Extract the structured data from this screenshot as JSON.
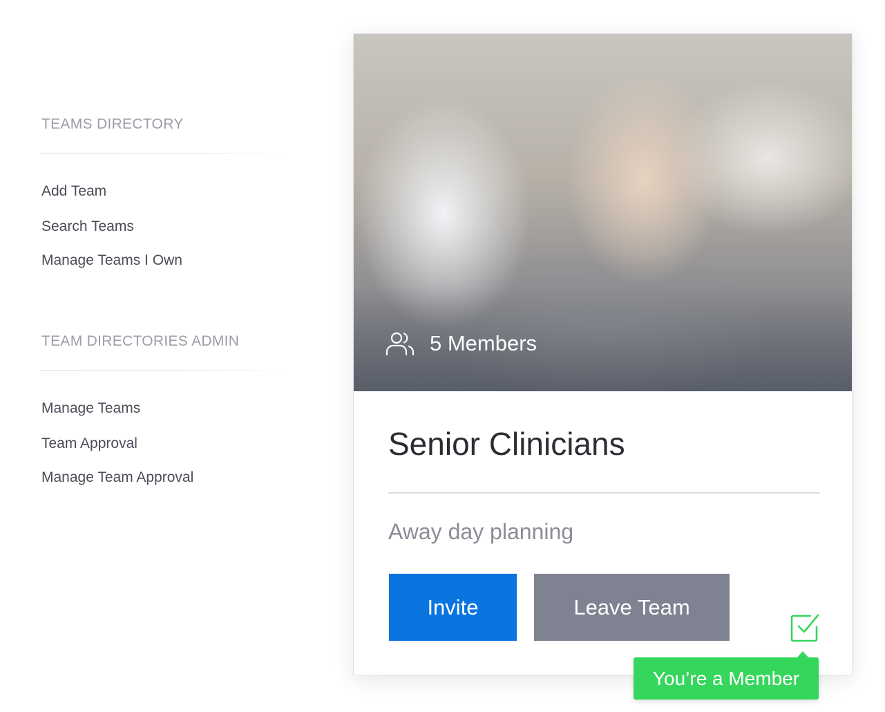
{
  "sidebar": {
    "sections": [
      {
        "title": "TEAMS DIRECTORY",
        "items": [
          "Add Team",
          "Search Teams",
          "Manage Teams I Own"
        ]
      },
      {
        "title": "TEAM DIRECTORIES ADMIN",
        "items": [
          "Manage Teams",
          "Team Approval",
          "Manage Team Approval"
        ]
      }
    ]
  },
  "card": {
    "members_icon": "users-icon",
    "members_label": "5 Members",
    "title": "Senior Clinicians",
    "subtitle": "Away day planning",
    "invite_label": "Invite",
    "leave_label": "Leave Team",
    "member_icon": "checkbox-checked-icon",
    "member_badge": "You’re a Member"
  },
  "colors": {
    "primary": "#0a74e0",
    "secondary": "#7e8291",
    "success": "#35d65c"
  }
}
